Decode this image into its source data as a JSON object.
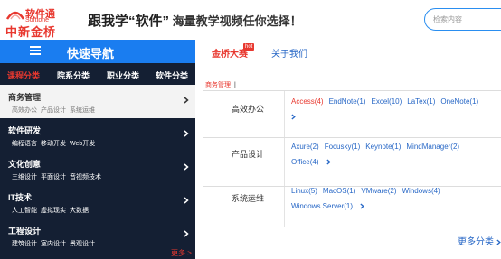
{
  "header": {
    "logo_brand": "软件通",
    "logo_sub": "Softtone",
    "logo_cn": "中新金桥",
    "slogan_main": "跟我学“软件”",
    "slogan_rest": " 海量教学视频任你选择！",
    "search_placeholder": "检索内容"
  },
  "nav": {
    "title": "快速导航",
    "tabs": [
      {
        "label": "金桥大赛",
        "badge": "hot"
      },
      {
        "label": "关于我们"
      }
    ]
  },
  "sidebar": {
    "tabs": [
      "课程分类",
      "院系分类",
      "职业分类",
      "软件分类"
    ],
    "groups": [
      {
        "title": "商务管理",
        "links": [
          "高效办公",
          "产品设计",
          "系统运维"
        ]
      },
      {
        "title": "软件研发",
        "links": [
          "编程语言",
          "移动开发",
          "Web开发"
        ]
      },
      {
        "title": "文化创意",
        "links": [
          "三维设计",
          "平面设计",
          "音视频技术"
        ]
      },
      {
        "title": "IT技术",
        "links": [
          "人工智能",
          "虚拟现实",
          "大数据"
        ]
      },
      {
        "title": "工程设计",
        "links": [
          "建筑设计",
          "室内设计",
          "景观设计"
        ]
      }
    ],
    "more": "更多 >"
  },
  "main": {
    "breadcrumb": "商务管理",
    "breadcrumb_sep": "|",
    "sections": [
      {
        "label": "高效办公",
        "links": [
          "Access(4)",
          "EndNote(1)",
          "Excel(10)",
          "LaTex(1)",
          "OneNote(1)"
        ]
      },
      {
        "label": "产品设计",
        "links": [
          "Axure(2)",
          "Focusky(1)",
          "Keynote(1)",
          "MindManager(2)",
          "Office(4)"
        ]
      },
      {
        "label": "系统运维",
        "links": [
          "Linux(5)",
          "MacOS(1)",
          "VMware(2)",
          "Windows(4)",
          "Windows Server(1)"
        ]
      }
    ],
    "more": "更多分类"
  },
  "colors": {
    "accent_blue": "#1a7df0",
    "accent_red": "#e8382f",
    "sidebar_bg": "#141f33",
    "link_blue": "#2767c6"
  }
}
